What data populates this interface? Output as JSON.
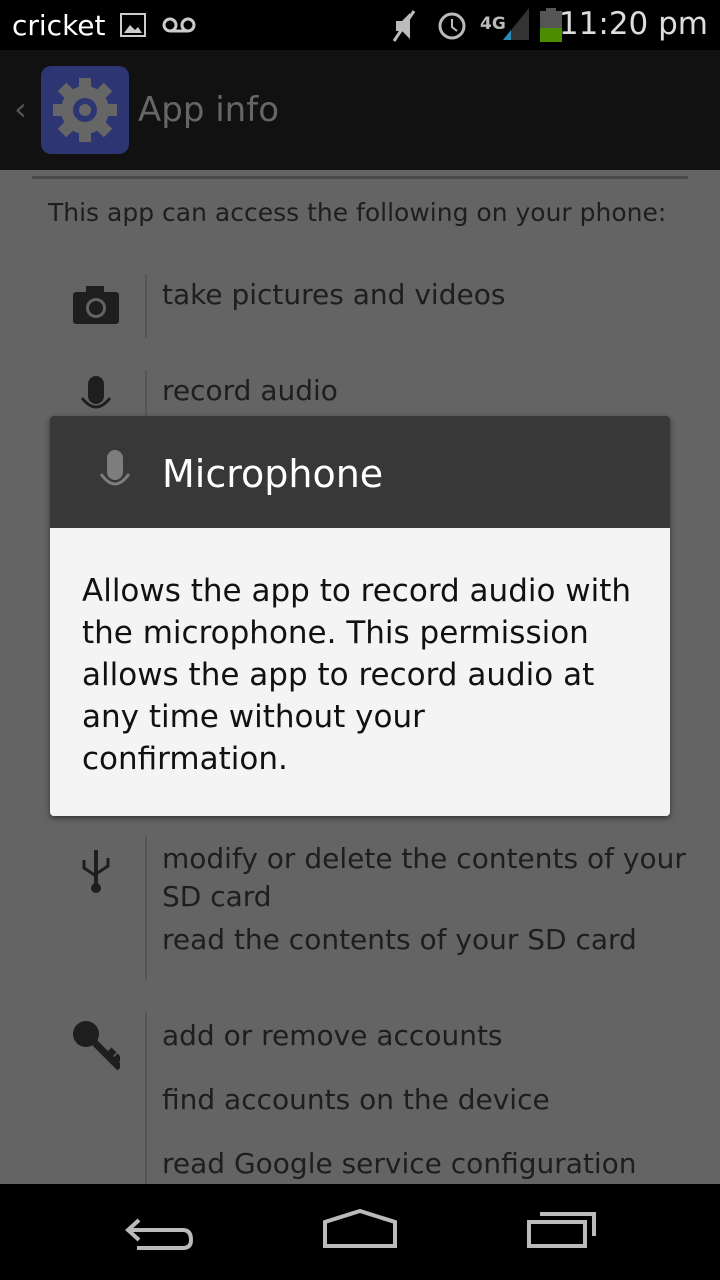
{
  "status_bar": {
    "carrier": "cricket",
    "time": "11:20 pm",
    "network": "4G",
    "icons": [
      "gallery-icon",
      "voicemail-icon",
      "mute-icon",
      "alarm-icon",
      "signal-icon",
      "battery-icon"
    ]
  },
  "action_bar": {
    "title": "App info",
    "icon": "settings-gear-icon"
  },
  "content": {
    "intro": "This app can access the following on your phone:",
    "groups": [
      {
        "icon": "camera-icon",
        "items": [
          "take pictures and videos"
        ]
      },
      {
        "icon": "microphone-icon",
        "items": [
          "record audio"
        ]
      },
      {
        "icon": "usb-icon",
        "items": [
          "modify or delete the contents of your SD card",
          "read the contents of your SD card"
        ]
      },
      {
        "icon": "key-icon",
        "items": [
          "add or remove accounts",
          "find accounts on the device",
          "read Google service configuration"
        ]
      }
    ]
  },
  "dialog": {
    "title": "Microphone",
    "body": "Allows the app to record audio with the microphone. This permission allows the app to record audio at any time without your confirmation."
  },
  "nav": {
    "back": "back-icon",
    "home": "home-icon",
    "recents": "recents-icon"
  },
  "colors": {
    "dialog_header": "#383838",
    "dialog_body": "#f4f4f4",
    "battery": "#4c8c00"
  }
}
